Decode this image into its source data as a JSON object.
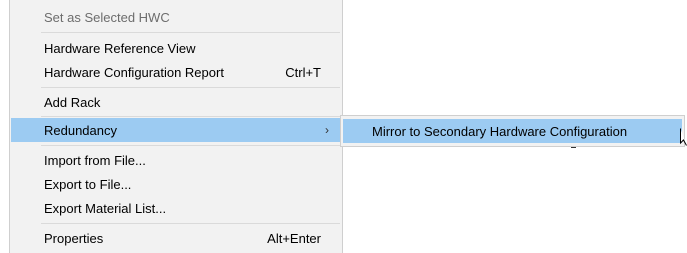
{
  "menu": {
    "items": [
      {
        "label": "Set as Selected HWC",
        "shortcut": "",
        "disabled": true
      },
      {
        "label": "Hardware Reference View",
        "shortcut": ""
      },
      {
        "label": "Hardware Configuration Report",
        "shortcut": "Ctrl+T"
      },
      {
        "label": "Add Rack",
        "shortcut": ""
      },
      {
        "label": "Redundancy",
        "shortcut": "",
        "submenu_arrow": "›"
      },
      {
        "label": "Import from File...",
        "shortcut": ""
      },
      {
        "label": "Export to File...",
        "shortcut": ""
      },
      {
        "label": "Export Material List...",
        "shortcut": ""
      },
      {
        "label": "Properties",
        "shortcut": "Alt+Enter"
      }
    ]
  },
  "submenu": {
    "items": [
      {
        "label": "Mirror to Secondary Hardware Configuration"
      }
    ]
  },
  "colors": {
    "menu_bg": "#f2f2f2",
    "highlight": "#9ccbf2",
    "disabled_text": "#6d6d6d"
  },
  "icons": {
    "cursor": "mouse-pointer-icon",
    "submenu_arrow": "chevron-right-icon"
  }
}
